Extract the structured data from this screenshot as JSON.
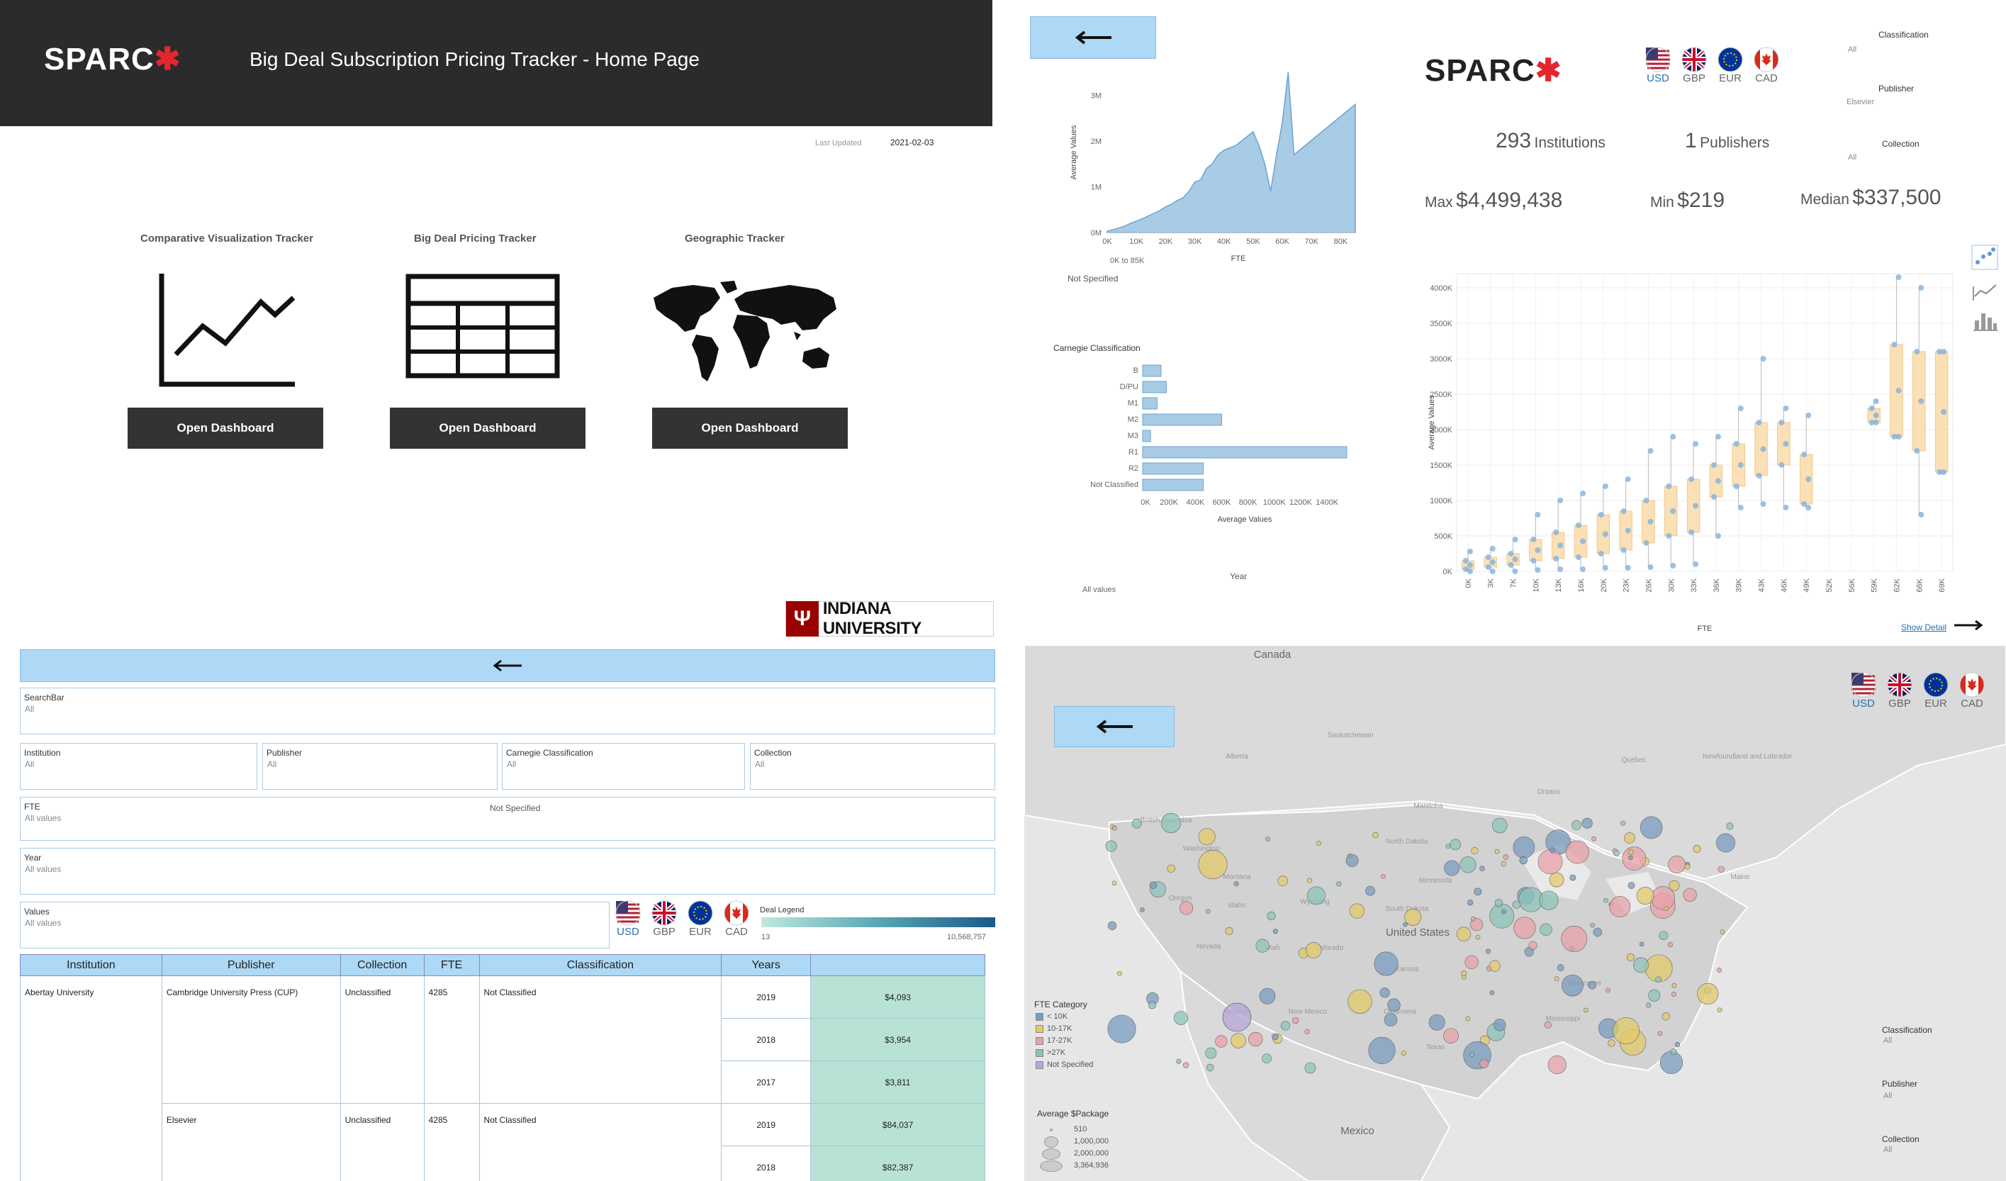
{
  "home": {
    "logo": "SPARC",
    "title": "Big Deal Subscription Pricing Tracker - Home Page",
    "last_updated_label": "Last Updated",
    "last_updated_value": "2021-02-03",
    "cards": [
      {
        "title": "Comparative Visualization Tracker",
        "icon": "line-chart-icon",
        "button": "Open Dashboard"
      },
      {
        "title": "Big Deal Pricing Tracker",
        "icon": "table-grid-icon",
        "button": "Open Dashboard"
      },
      {
        "title": "Geographic Tracker",
        "icon": "world-map-icon",
        "button": "Open Dashboard"
      }
    ]
  },
  "comparative": {
    "back_icon": "arrow-left-icon",
    "logo": "SPARC",
    "currencies": [
      "USD",
      "GBP",
      "EUR",
      "CAD"
    ],
    "selected_currency": "USD",
    "filters": [
      {
        "label": "Classification",
        "value": "All"
      },
      {
        "label": "Publisher",
        "value": "Elsevier"
      },
      {
        "label": "Collection",
        "value": "All"
      }
    ],
    "stats": {
      "institutions_num": "293",
      "institutions_label": "Institutions",
      "publishers_num": "1",
      "publishers_label": "Publishers",
      "max_label": "Max",
      "max_value": "$4,499,438",
      "min_label": "Min",
      "min_value": "$219",
      "median_label": "Median",
      "median_value": "$337,500"
    },
    "fte_slider_label": "0K to 85K",
    "not_specified": "Not Specified",
    "year_label": "Year",
    "year_value": "All values",
    "show_detail": "Show Detail",
    "view_icons": [
      "scatter-icon",
      "line-icon",
      "bar-icon"
    ]
  },
  "chart_data": [
    {
      "type": "area",
      "xlabel": "FTE",
      "ylabel": "Average Values",
      "x_ticks": [
        "0K",
        "10K",
        "20K",
        "30K",
        "40K",
        "50K",
        "60K",
        "70K",
        "80K"
      ],
      "y_ticks": [
        "0M",
        "1M",
        "2M",
        "3M"
      ],
      "xlim": [
        0,
        85000
      ],
      "ylim": [
        0,
        3500000
      ],
      "x": [
        0,
        2000,
        4000,
        6000,
        8000,
        10000,
        12000,
        14000,
        16000,
        18000,
        20000,
        22000,
        24000,
        26000,
        28000,
        30000,
        32000,
        34000,
        36000,
        38000,
        40000,
        42000,
        44000,
        46000,
        48000,
        50000,
        52000,
        54000,
        56000,
        58000,
        60000,
        62000,
        64000,
        85000
      ],
      "y": [
        30000,
        60000,
        100000,
        140000,
        200000,
        250000,
        300000,
        360000,
        420000,
        480000,
        560000,
        620000,
        700000,
        760000,
        900000,
        1100000,
        1150000,
        1400000,
        1500000,
        1700000,
        1800000,
        1850000,
        1900000,
        2000000,
        2100000,
        2200000,
        1900000,
        1500000,
        900000,
        1700000,
        2400000,
        3500000,
        1700000,
        2800000
      ]
    },
    {
      "type": "bar",
      "title": "Carnegie Classification",
      "xlabel": "Average Values",
      "categories": [
        "B",
        "D/PU",
        "M1",
        "M2",
        "M3",
        "R1",
        "R2",
        "Not Classified"
      ],
      "values": [
        140000,
        180000,
        110000,
        600000,
        60000,
        1550000,
        460000,
        460000
      ],
      "x_ticks": [
        "0K",
        "200K",
        "400K",
        "600K",
        "800K",
        "1000K",
        "1200K",
        "1400K"
      ],
      "xlim": [
        0,
        1550000
      ]
    },
    {
      "type": "scatter",
      "xlabel": "FTE",
      "ylabel": "Average Values",
      "categories": [
        "0K",
        "3K",
        "7K",
        "10K",
        "13K",
        "16K",
        "20K",
        "23K",
        "26K",
        "30K",
        "33K",
        "36K",
        "39K",
        "43K",
        "46K",
        "49K",
        "52K",
        "56K",
        "59K",
        "62K",
        "66K",
        "69K"
      ],
      "y_ticks": [
        "0K",
        "500K",
        "1000K",
        "1500K",
        "2000K",
        "2500K",
        "3000K",
        "3500K",
        "4000K"
      ],
      "ylim": [
        0,
        4200000
      ],
      "box": [
        {
          "cat": "0K",
          "q1": 30000,
          "q3": 150000,
          "min": 0,
          "max": 280000
        },
        {
          "cat": "3K",
          "q1": 60000,
          "q3": 200000,
          "min": 0,
          "max": 320000
        },
        {
          "cat": "7K",
          "q1": 90000,
          "q3": 250000,
          "min": 0,
          "max": 450000
        },
        {
          "cat": "10K",
          "q1": 150000,
          "q3": 450000,
          "min": 20000,
          "max": 800000
        },
        {
          "cat": "13K",
          "q1": 180000,
          "q3": 550000,
          "min": 30000,
          "max": 1000000
        },
        {
          "cat": "16K",
          "q1": 200000,
          "q3": 650000,
          "min": 30000,
          "max": 1100000
        },
        {
          "cat": "20K",
          "q1": 250000,
          "q3": 800000,
          "min": 50000,
          "max": 1200000
        },
        {
          "cat": "23K",
          "q1": 300000,
          "q3": 850000,
          "min": 50000,
          "max": 1300000
        },
        {
          "cat": "26K",
          "q1": 400000,
          "q3": 1000000,
          "min": 60000,
          "max": 1700000
        },
        {
          "cat": "30K",
          "q1": 500000,
          "q3": 1200000,
          "min": 80000,
          "max": 1900000
        },
        {
          "cat": "33K",
          "q1": 550000,
          "q3": 1300000,
          "min": 100000,
          "max": 1800000
        },
        {
          "cat": "36K",
          "q1": 1050000,
          "q3": 1500000,
          "min": 500000,
          "max": 1900000
        },
        {
          "cat": "39K",
          "q1": 1200000,
          "q3": 1800000,
          "min": 900000,
          "max": 2300000
        },
        {
          "cat": "43K",
          "q1": 1350000,
          "q3": 2100000,
          "min": 950000,
          "max": 3000000
        },
        {
          "cat": "46K",
          "q1": 1500000,
          "q3": 2100000,
          "min": 900000,
          "max": 2300000
        },
        {
          "cat": "49K",
          "q1": 950000,
          "q3": 1650000,
          "min": 900000,
          "max": 2200000
        },
        {
          "cat": "59K",
          "q1": 2100000,
          "q3": 2300000,
          "min": 2100000,
          "max": 2400000
        },
        {
          "cat": "62K",
          "q1": 1900000,
          "q3": 3200000,
          "min": 1900000,
          "max": 4150000
        },
        {
          "cat": "66K",
          "q1": 1700000,
          "q3": 3100000,
          "min": 800000,
          "max": 4000000
        },
        {
          "cat": "69K",
          "q1": 1400000,
          "q3": 3100000,
          "min": 1400000,
          "max": 3100000
        }
      ]
    }
  ],
  "pricing": {
    "iu_logo": "INDIANA UNIVERSITY",
    "back_icon": "arrow-left-icon",
    "filters": {
      "searchbar": {
        "label": "SearchBar",
        "value": "All"
      },
      "institution": {
        "label": "Institution",
        "value": "All"
      },
      "publisher": {
        "label": "Publisher",
        "value": "All"
      },
      "carnegie": {
        "label": "Carnegie Classification",
        "value": "All"
      },
      "collection": {
        "label": "Collection",
        "value": "All"
      },
      "fte": {
        "label": "FTE",
        "value": "All values",
        "not_specified": "Not Specified"
      },
      "year": {
        "label": "Year",
        "value": "All values"
      },
      "values": {
        "label": "Values",
        "value": "All values"
      }
    },
    "currencies": [
      "USD",
      "GBP",
      "EUR",
      "CAD"
    ],
    "deal_legend": {
      "label": "Deal Legend",
      "min": "13",
      "max": "10,568,757"
    },
    "columns": [
      "Institution",
      "Publisher",
      "Collection",
      "FTE",
      "Classification",
      "Years",
      ""
    ],
    "institution": "Abertay University",
    "groups": [
      {
        "publisher": "Cambridge University Press (CUP)",
        "collection": "Unclassified",
        "fte": "4285",
        "classification": "Not Classified",
        "rows": [
          {
            "year": "2019",
            "value": "$4,093"
          },
          {
            "year": "2018",
            "value": "$3,954"
          },
          {
            "year": "2017",
            "value": "$3,811"
          }
        ]
      },
      {
        "publisher": "Elsevier",
        "collection": "Unclassified",
        "fte": "4285",
        "classification": "Not Classified",
        "rows": [
          {
            "year": "2019",
            "value": "$84,037"
          },
          {
            "year": "2018",
            "value": "$82,387"
          }
        ]
      }
    ]
  },
  "geo": {
    "back_icon": "arrow-left-icon",
    "currencies": [
      "USD",
      "GBP",
      "EUR",
      "CAD"
    ],
    "map_labels": [
      "Canada",
      "Saskatchewan",
      "Alberta",
      "Manitoba",
      "Ontario",
      "Quebec",
      "Newfoundland and Labrador",
      "British Columbia",
      "Washington",
      "Oregon",
      "Montana",
      "North Dakota",
      "Minnesota",
      "South Dakota",
      "Idaho",
      "Wyoming",
      "Nevada",
      "Utah",
      "Colorado",
      "Kansas",
      "United States",
      "Arizona",
      "New Mexico",
      "Oklahoma",
      "Texas",
      "Tennessee",
      "Mississippi",
      "Mexico",
      "Maine"
    ],
    "fte_legend": {
      "title": "FTE Category",
      "items": [
        {
          "label": "< 10K",
          "color": "#7a9bbf"
        },
        {
          "label": "10-17K",
          "color": "#e2c96a"
        },
        {
          "label": "17-27K",
          "color": "#e8a1a8"
        },
        {
          "label": ">27K",
          "color": "#8cc4b8"
        },
        {
          "label": "Not Specified",
          "color": "#b8a8d8"
        }
      ]
    },
    "size_legend": {
      "title": "Average $Package",
      "items": [
        "510",
        "1,000,000",
        "2,000,000",
        "3,364,936"
      ]
    },
    "filters": [
      {
        "label": "Classification",
        "value": "All"
      },
      {
        "label": "Publisher",
        "value": "All"
      },
      {
        "label": "Collection",
        "value": "All"
      }
    ]
  },
  "colors": {
    "dark": "#2b2b2b",
    "button": "#333333",
    "accent_blue": "#add8f6",
    "brand_red": "#e4262d",
    "area": "#a8cbe6",
    "box": "#fbdfb5",
    "value_cell": "#b8e2d4",
    "iu_red": "#990000"
  }
}
